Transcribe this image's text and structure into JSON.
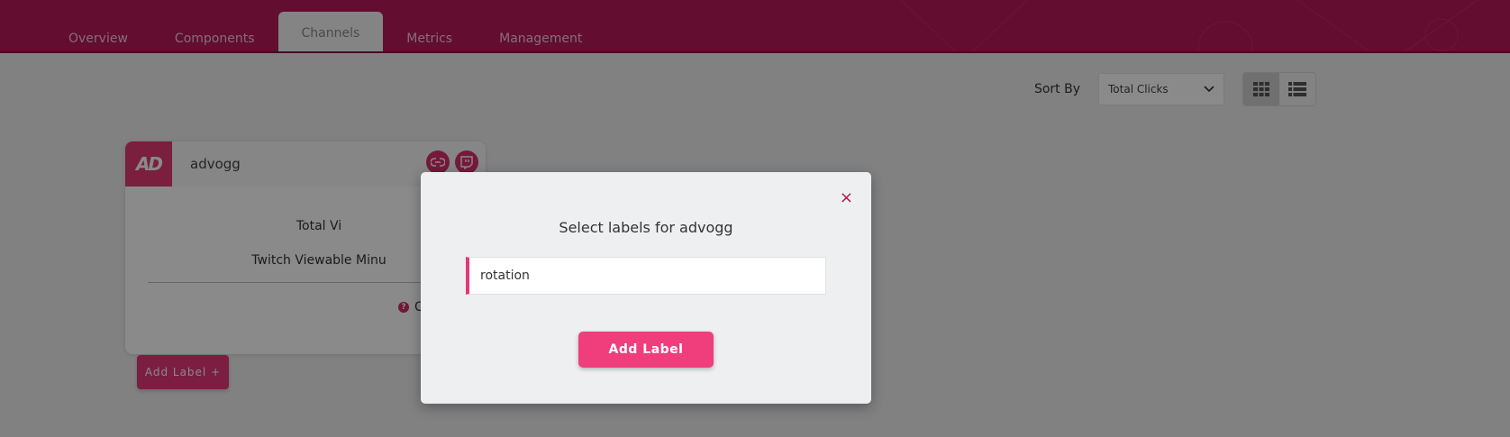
{
  "nav": {
    "tabs": [
      {
        "label": "Overview"
      },
      {
        "label": "Components"
      },
      {
        "label": "Channels"
      },
      {
        "label": "Metrics"
      },
      {
        "label": "Management"
      }
    ],
    "active_tab": "Channels"
  },
  "toolbar": {
    "sort_label": "Sort By",
    "sort_value": "Total Clicks"
  },
  "card": {
    "logo_text": "AD",
    "name": "advogg",
    "stat1_label": "Total Vi",
    "stat2_label": "Twitch Viewable Minu",
    "help_text": "C",
    "add_label_button": "Add Label +"
  },
  "modal": {
    "close": "×",
    "title": "Select labels for advogg",
    "input_value": "rotation",
    "submit_label": "Add Label"
  },
  "colors": {
    "brand": "#b8185a",
    "accent": "#f03e7c"
  },
  "icons": [
    "link-icon",
    "twitch-icon",
    "grid-view-icon",
    "list-view-icon",
    "chevron-down-icon",
    "close-icon",
    "help-icon"
  ]
}
